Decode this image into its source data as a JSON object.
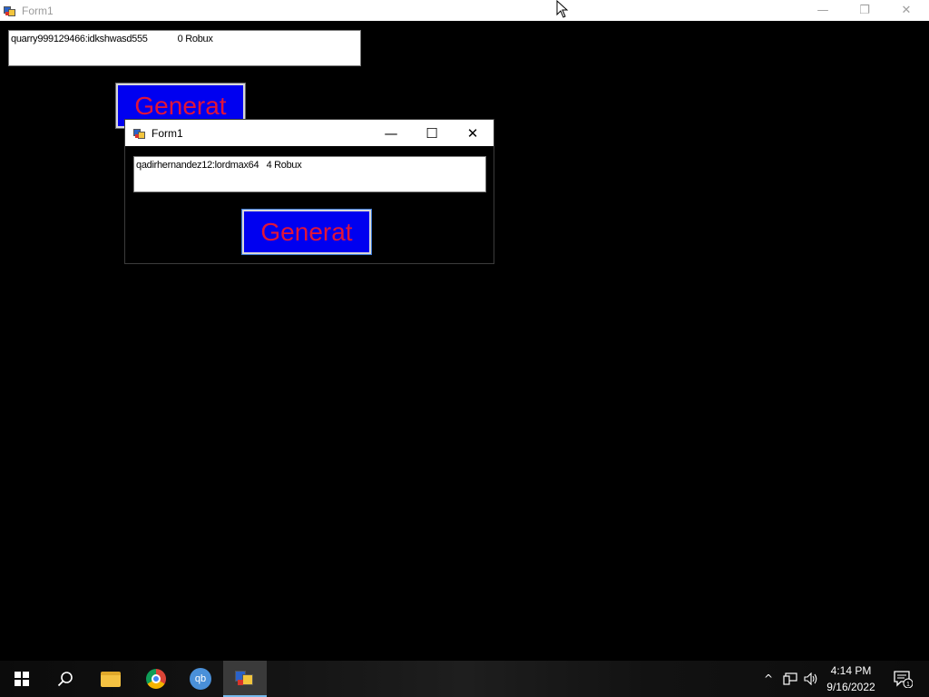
{
  "background_window": {
    "title": "Form1",
    "controls": {
      "minimize": "—",
      "restore": "❐",
      "close": "✕"
    },
    "textbox_text": "quarry999129466:idkshwasd555            0 Robux",
    "generate_label": "Generat"
  },
  "dialog": {
    "title": "Form1",
    "controls": {
      "minimize": "—",
      "maximize": "☐",
      "close": "✕"
    },
    "textbox_text": "qadirhernandez12:lordmax64   4 Robux",
    "generate_label": "Generat"
  },
  "taskbar": {
    "apps": [
      {
        "name": "Start",
        "icon": "windows-logo-icon"
      },
      {
        "name": "Search",
        "icon": "search-icon"
      },
      {
        "name": "File Explorer",
        "icon": "folder-icon"
      },
      {
        "name": "Google Chrome",
        "icon": "chrome-icon"
      },
      {
        "name": "qBittorrent",
        "icon": "qbittorrent-icon",
        "label": "qb"
      },
      {
        "name": "Form1",
        "icon": "form-app-icon",
        "active": true
      }
    ],
    "tray": {
      "chevron": "^",
      "network": "network-icon",
      "volume": "volume-icon",
      "time": "4:14 PM",
      "date": "9/16/2022",
      "notifications_count": "1"
    }
  },
  "colors": {
    "button_fill": "#0000f0",
    "button_text": "#e0143a",
    "taskbar_accent": "#76b9ed"
  }
}
